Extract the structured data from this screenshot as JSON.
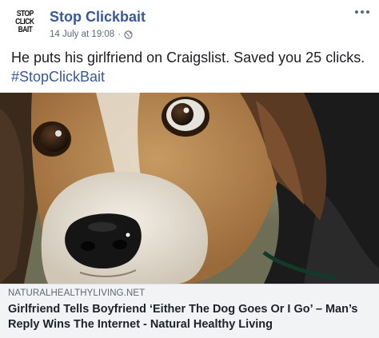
{
  "page": {
    "avatar_lines": [
      "STOP",
      "CLICK",
      "BAIT"
    ],
    "name": "Stop Clickbait",
    "timestamp": "14 July at 19:08",
    "separator": "·",
    "privacy_icon": "globe-icon",
    "more_icon": "more-options-icon"
  },
  "post": {
    "text": "He puts his girlfriend on Craigslist. Saved you 25 clicks. ",
    "hashtag": "#StopClickBait"
  },
  "photo": {
    "subject": "beagle-dog-photo"
  },
  "link": {
    "domain": "NATURALHEALTHYLIVING.NET",
    "title": "Girlfriend Tells Boyfriend ‘Either The Dog Goes Or I Go’ – Man’s Reply Wins The Internet - Natural Healthy Living"
  },
  "colors": {
    "page_name": "#385898",
    "meta_text": "#606770",
    "link_box_bg": "#f2f3f5"
  }
}
